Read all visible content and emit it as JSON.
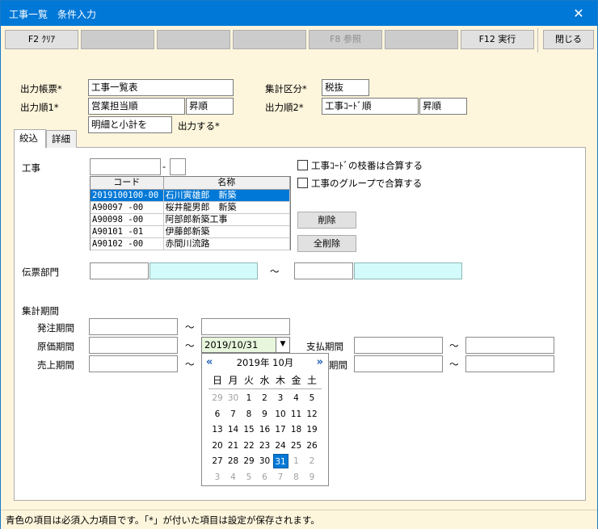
{
  "window": {
    "title": "工事一覧　条件入力",
    "close_glyph": "✕"
  },
  "toolbar": {
    "f2": "F2 ｸﾘｱ",
    "f3": "",
    "f4": "",
    "f5": "",
    "f8": "F8 参照",
    "f9": "",
    "f12": "F12 実行",
    "close": "閉じる"
  },
  "header": {
    "report_label": "出力帳票*",
    "report_value": "工事一覧表",
    "agg_label": "集計区分*",
    "agg_value": "税抜",
    "order1_label": "出力順1*",
    "order1_value": "営業担当順",
    "order1_dir": "昇順",
    "order2_label": "出力順2*",
    "order2_value": "工事ｺｰﾄﾞ順",
    "order2_dir": "昇順",
    "detail_value": "明細と小計を",
    "detail_suffix": "出力する*"
  },
  "tabs": {
    "filter": "絞込",
    "detail": "詳細"
  },
  "filter": {
    "koji_label": "工事",
    "koji_from": "",
    "koji_dash": "-",
    "koji_sub": "",
    "grid": {
      "col_code": "コード",
      "col_name": "名称",
      "rows": [
        {
          "code": "2019100100-00",
          "name": "石川寅雄郎　新築"
        },
        {
          "code": "A90097      -00",
          "name": "桜井龍男郎　新築"
        },
        {
          "code": "A90098      -00",
          "name": "阿部郎新築工事"
        },
        {
          "code": "A90101      -01",
          "name": "伊藤郎新築"
        },
        {
          "code": "A90102      -00",
          "name": "赤間川流路"
        }
      ]
    },
    "chk_branch": "工事ｺｰﾄﾞの枝番は合算する",
    "chk_group": "工事のグループで合算する",
    "btn_delete": "削除",
    "btn_delete_all": "全削除",
    "dept_label": "伝票部門",
    "tilde": "～",
    "period_label": "集計期間",
    "order_period": "発注期間",
    "cost_period": "原価期間",
    "cost_to": "2019/10/31",
    "sales_period": "売上期間",
    "pay_period": "支払期間",
    "hidden_period_suffix": "期間"
  },
  "calendar": {
    "title": "2019年  10月",
    "prev": "«",
    "next": "»",
    "dow": [
      "日",
      "月",
      "火",
      "水",
      "木",
      "金",
      "土"
    ],
    "weeks": [
      [
        "29",
        "30",
        "1",
        "2",
        "3",
        "4",
        "5"
      ],
      [
        "6",
        "7",
        "8",
        "9",
        "10",
        "11",
        "12"
      ],
      [
        "13",
        "14",
        "15",
        "16",
        "17",
        "18",
        "19"
      ],
      [
        "20",
        "21",
        "22",
        "23",
        "24",
        "25",
        "26"
      ],
      [
        "27",
        "28",
        "29",
        "30",
        "31",
        "1",
        "2"
      ],
      [
        "3",
        "4",
        "5",
        "6",
        "7",
        "8",
        "9"
      ]
    ],
    "selected": "31"
  },
  "status": {
    "text": "青色の項目は必須入力項目です。「*」が付いた項目は設定が保存されます。"
  },
  "colors": {
    "titlebar": "#0078d7",
    "background": "#fdf5dc",
    "required": "#d3fbfb",
    "selection": "#0078d7"
  }
}
